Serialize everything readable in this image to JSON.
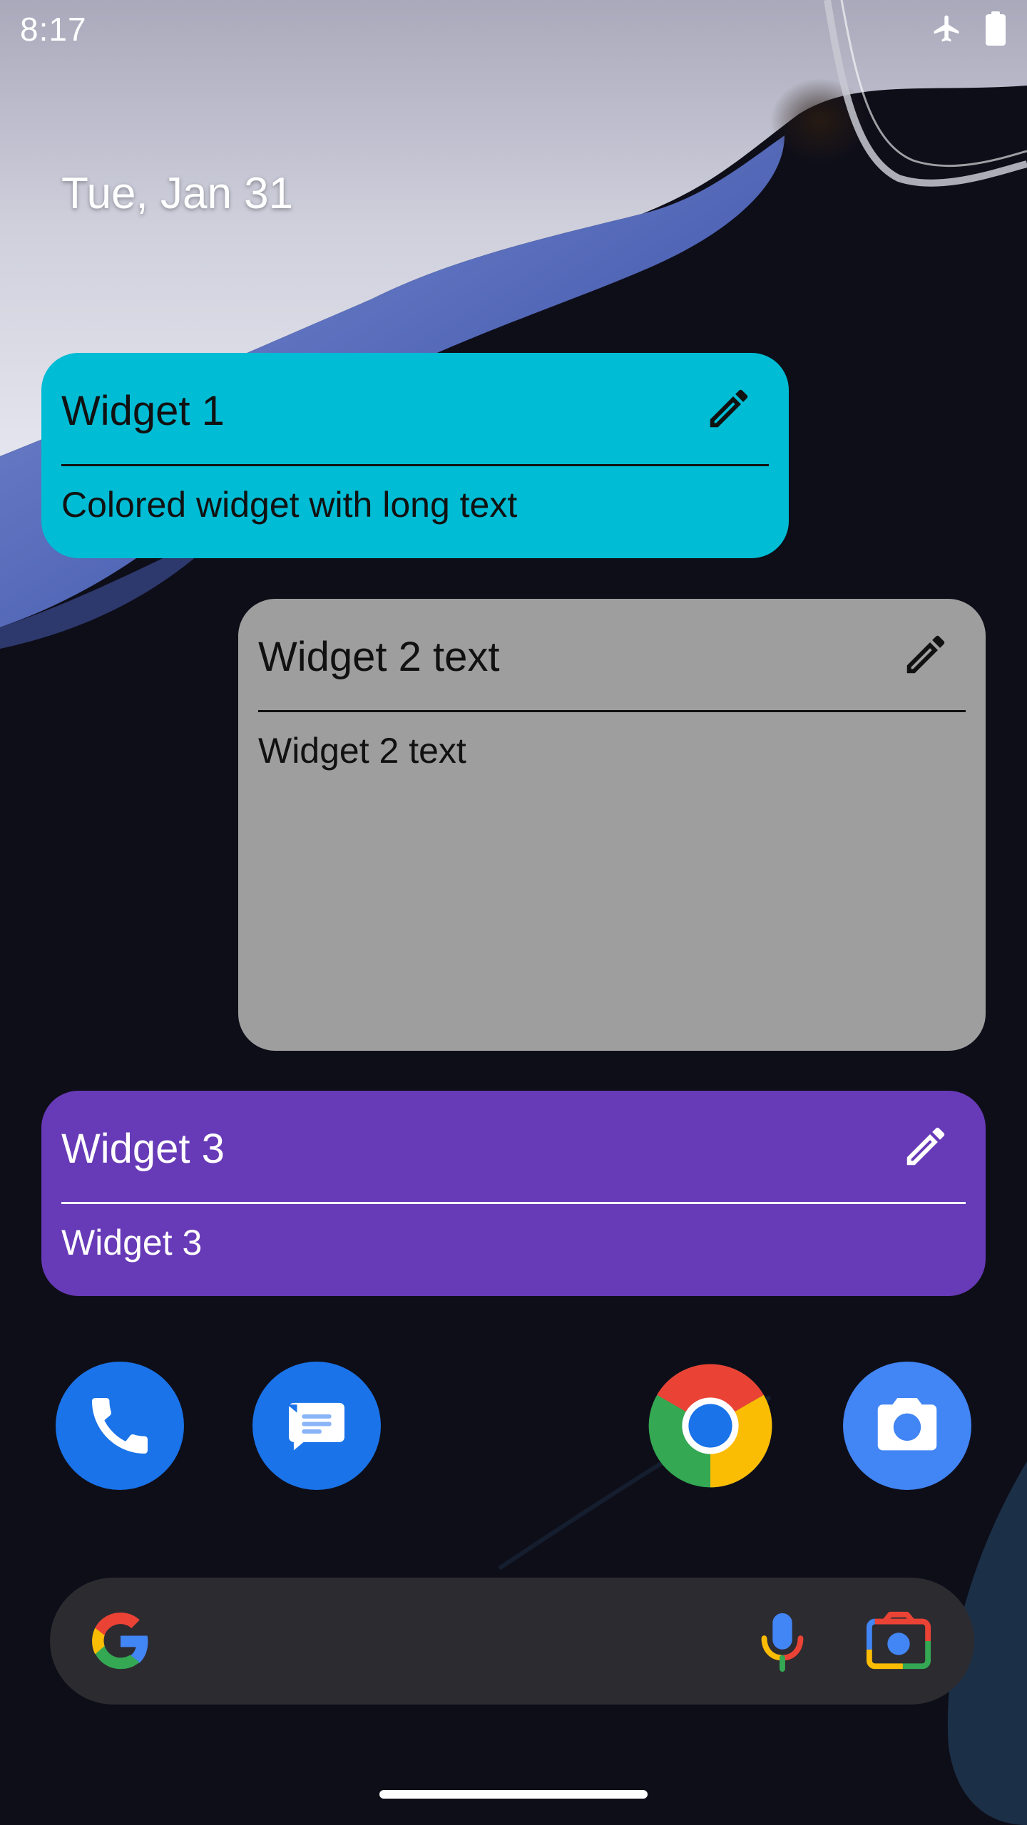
{
  "status_bar": {
    "time": "8:17",
    "icons": [
      "airplane-mode-icon",
      "battery-full-icon"
    ]
  },
  "home": {
    "date": "Tue, Jan 31"
  },
  "widgets": [
    {
      "title": "Widget 1",
      "body": "Colored widget with long text",
      "background": "#00bcd4",
      "text_color": "#111111",
      "edit_icon": "pencil-icon"
    },
    {
      "title": "Widget 2 text",
      "body": "Widget 2 text",
      "background": "#9e9e9e",
      "text_color": "#111111",
      "edit_icon": "pencil-icon"
    },
    {
      "title": "Widget 3",
      "body": "Widget 3",
      "background": "#673ab7",
      "text_color": "#ffffff",
      "edit_icon": "pencil-icon"
    }
  ],
  "dock": {
    "apps": [
      {
        "icon": "phone-icon",
        "color": "#1a73e8"
      },
      {
        "icon": "messages-icon",
        "color": "#1a73e8"
      },
      {
        "icon": "chrome-icon",
        "color": "#ea4335"
      },
      {
        "icon": "camera-icon",
        "color": "#4285f4"
      }
    ]
  },
  "search_bar": {
    "icons": [
      "google-g-icon",
      "microphone-icon",
      "google-lens-icon"
    ]
  },
  "colors": {
    "google_blue": "#4285f4",
    "google_red": "#ea4335",
    "google_yellow": "#fbbc04",
    "google_green": "#34a853"
  }
}
